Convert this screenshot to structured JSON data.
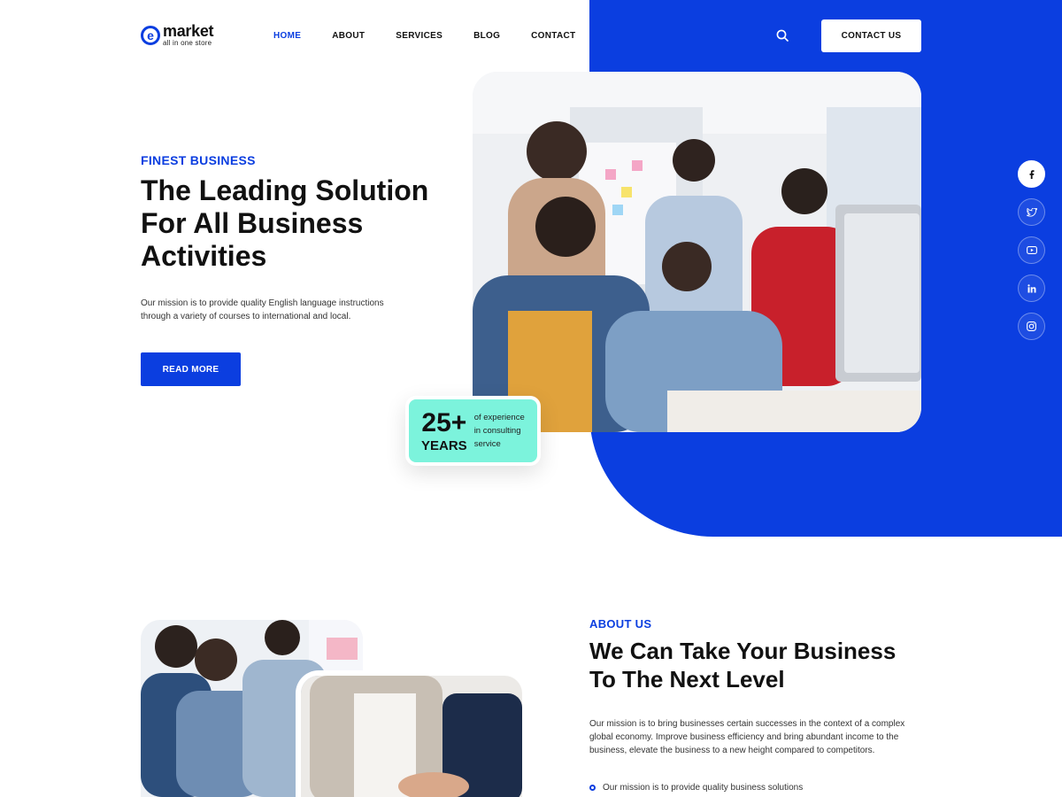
{
  "brand": {
    "mark": "e",
    "name": "market",
    "tagline": "all in one store",
    "primary_color": "#0b3ee0",
    "accent_color": "#7cf3dc"
  },
  "nav": {
    "items": [
      {
        "label": "HOME",
        "active": true
      },
      {
        "label": "ABOUT",
        "active": false
      },
      {
        "label": "SERVICES",
        "active": false
      },
      {
        "label": "BLOG",
        "active": false
      },
      {
        "label": "CONTACT",
        "active": false
      }
    ],
    "search_icon": "search-icon",
    "cta_label": "CONTACT US"
  },
  "hero": {
    "eyebrow": "FINEST BUSINESS",
    "title_lines": [
      "The Leading Solution",
      "For All Business",
      "Activities"
    ],
    "description": "Our mission is to provide quality English language instructions through a variety of courses to international and local.",
    "button_label": "READ MORE",
    "experience": {
      "number": "25+",
      "unit": "YEARS",
      "description": "of experience in consulting service"
    }
  },
  "social": [
    {
      "icon": "facebook-icon",
      "active": true
    },
    {
      "icon": "twitter-icon",
      "active": false
    },
    {
      "icon": "youtube-icon",
      "active": false
    },
    {
      "icon": "linkedin-icon",
      "active": false
    },
    {
      "icon": "instagram-icon",
      "active": false
    }
  ],
  "about": {
    "eyebrow": "ABOUT US",
    "title_lines": [
      "We Can Take Your Business",
      "To The Next Level"
    ],
    "description": "Our mission is to bring businesses certain successes in the context of a complex global economy. Improve business efficiency and bring abundant income to the business, elevate the business to a new height compared to competitors.",
    "bullets": [
      "Our mission is to provide quality business solutions"
    ]
  }
}
